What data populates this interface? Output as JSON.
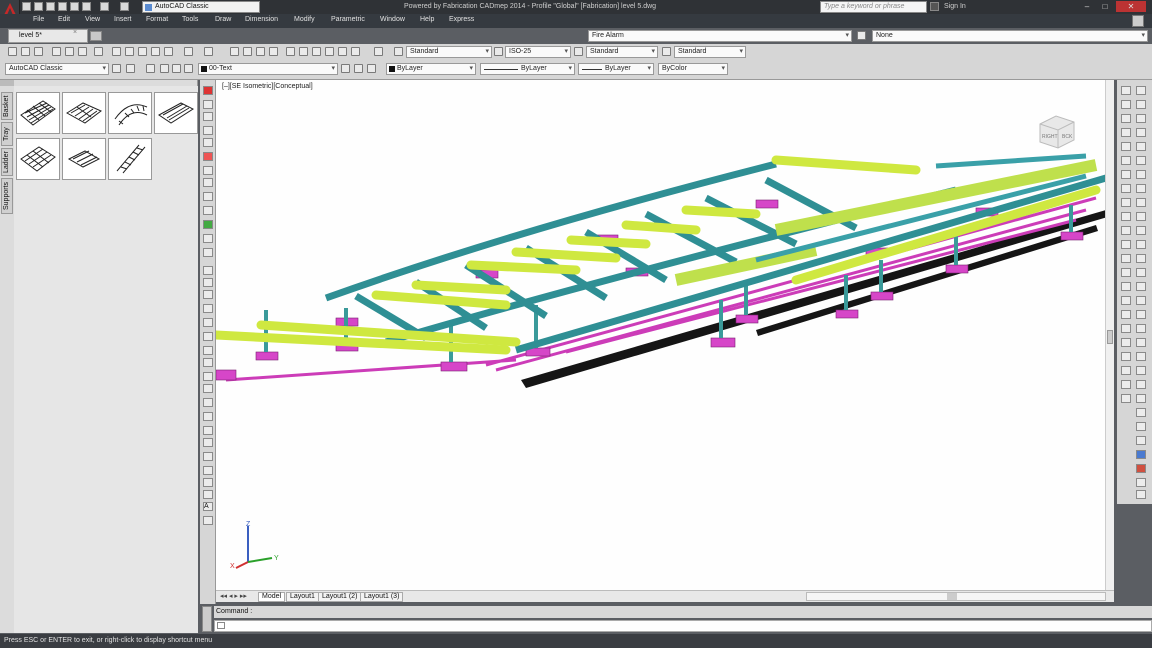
{
  "window": {
    "title": "Powered by Fabrication CADmep 2014 - Profile \"Global\" [Fabrication]   level 5.dwg",
    "workspace": "AutoCAD Classic",
    "search_placeholder": "Type a keyword or phrase",
    "sign_in": "Sign In"
  },
  "menu": [
    "File",
    "Edit",
    "View",
    "Insert",
    "Format",
    "Tools",
    "Draw",
    "Dimension",
    "Modify",
    "Parametric",
    "Window",
    "Help",
    "Express"
  ],
  "document_tab": "level 5*",
  "toolbar": {
    "workspace_combo": "AutoCAD Classic",
    "layer_combo": "00-Text",
    "text_style": "Standard",
    "dim_style": "ISO-25",
    "table_style": "Standard",
    "mleader_style": "Standard",
    "color": "ByLayer",
    "linetype": "ByLayer",
    "lineweight": "ByLayer",
    "plot_style": "ByColor",
    "service_combo": "Fire Alarm",
    "service_type_combo": "None"
  },
  "palette": {
    "tabs": [
      "Basket",
      "Tray",
      "Ladder",
      "Supports"
    ]
  },
  "viewport": {
    "label": "[–][SE Isometric][Conceptual]",
    "viewcube_labels": [
      "RIGHT",
      "BCK"
    ]
  },
  "layout_tabs": [
    "Model",
    "Layout1",
    "Layout1 (2)",
    "Layout1 (3)"
  ],
  "command": {
    "label": "Command :",
    "input": ""
  },
  "status": "Press ESC or ENTER to exit, or right-click to display shortcut menu",
  "colors": {
    "duct": "#3a9a9a",
    "pipe": "#d4f04a",
    "support": "#e040c0",
    "tray": "#111111"
  }
}
